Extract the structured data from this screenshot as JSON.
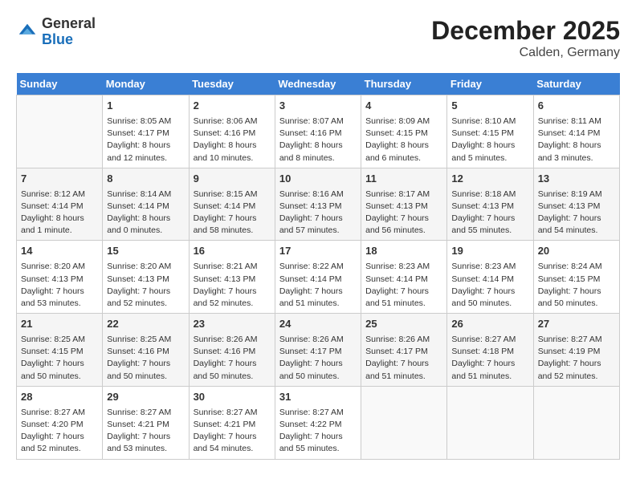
{
  "header": {
    "logo_general": "General",
    "logo_blue": "Blue",
    "month_year": "December 2025",
    "location": "Calden, Germany"
  },
  "weekdays": [
    "Sunday",
    "Monday",
    "Tuesday",
    "Wednesday",
    "Thursday",
    "Friday",
    "Saturday"
  ],
  "weeks": [
    [
      {
        "day": "",
        "empty": true
      },
      {
        "day": "1",
        "sunrise": "Sunrise: 8:05 AM",
        "sunset": "Sunset: 4:17 PM",
        "daylight": "Daylight: 8 hours and 12 minutes."
      },
      {
        "day": "2",
        "sunrise": "Sunrise: 8:06 AM",
        "sunset": "Sunset: 4:16 PM",
        "daylight": "Daylight: 8 hours and 10 minutes."
      },
      {
        "day": "3",
        "sunrise": "Sunrise: 8:07 AM",
        "sunset": "Sunset: 4:16 PM",
        "daylight": "Daylight: 8 hours and 8 minutes."
      },
      {
        "day": "4",
        "sunrise": "Sunrise: 8:09 AM",
        "sunset": "Sunset: 4:15 PM",
        "daylight": "Daylight: 8 hours and 6 minutes."
      },
      {
        "day": "5",
        "sunrise": "Sunrise: 8:10 AM",
        "sunset": "Sunset: 4:15 PM",
        "daylight": "Daylight: 8 hours and 5 minutes."
      },
      {
        "day": "6",
        "sunrise": "Sunrise: 8:11 AM",
        "sunset": "Sunset: 4:14 PM",
        "daylight": "Daylight: 8 hours and 3 minutes."
      }
    ],
    [
      {
        "day": "7",
        "sunrise": "Sunrise: 8:12 AM",
        "sunset": "Sunset: 4:14 PM",
        "daylight": "Daylight: 8 hours and 1 minute."
      },
      {
        "day": "8",
        "sunrise": "Sunrise: 8:14 AM",
        "sunset": "Sunset: 4:14 PM",
        "daylight": "Daylight: 8 hours and 0 minutes."
      },
      {
        "day": "9",
        "sunrise": "Sunrise: 8:15 AM",
        "sunset": "Sunset: 4:14 PM",
        "daylight": "Daylight: 7 hours and 58 minutes."
      },
      {
        "day": "10",
        "sunrise": "Sunrise: 8:16 AM",
        "sunset": "Sunset: 4:13 PM",
        "daylight": "Daylight: 7 hours and 57 minutes."
      },
      {
        "day": "11",
        "sunrise": "Sunrise: 8:17 AM",
        "sunset": "Sunset: 4:13 PM",
        "daylight": "Daylight: 7 hours and 56 minutes."
      },
      {
        "day": "12",
        "sunrise": "Sunrise: 8:18 AM",
        "sunset": "Sunset: 4:13 PM",
        "daylight": "Daylight: 7 hours and 55 minutes."
      },
      {
        "day": "13",
        "sunrise": "Sunrise: 8:19 AM",
        "sunset": "Sunset: 4:13 PM",
        "daylight": "Daylight: 7 hours and 54 minutes."
      }
    ],
    [
      {
        "day": "14",
        "sunrise": "Sunrise: 8:20 AM",
        "sunset": "Sunset: 4:13 PM",
        "daylight": "Daylight: 7 hours and 53 minutes."
      },
      {
        "day": "15",
        "sunrise": "Sunrise: 8:20 AM",
        "sunset": "Sunset: 4:13 PM",
        "daylight": "Daylight: 7 hours and 52 minutes."
      },
      {
        "day": "16",
        "sunrise": "Sunrise: 8:21 AM",
        "sunset": "Sunset: 4:13 PM",
        "daylight": "Daylight: 7 hours and 52 minutes."
      },
      {
        "day": "17",
        "sunrise": "Sunrise: 8:22 AM",
        "sunset": "Sunset: 4:14 PM",
        "daylight": "Daylight: 7 hours and 51 minutes."
      },
      {
        "day": "18",
        "sunrise": "Sunrise: 8:23 AM",
        "sunset": "Sunset: 4:14 PM",
        "daylight": "Daylight: 7 hours and 51 minutes."
      },
      {
        "day": "19",
        "sunrise": "Sunrise: 8:23 AM",
        "sunset": "Sunset: 4:14 PM",
        "daylight": "Daylight: 7 hours and 50 minutes."
      },
      {
        "day": "20",
        "sunrise": "Sunrise: 8:24 AM",
        "sunset": "Sunset: 4:15 PM",
        "daylight": "Daylight: 7 hours and 50 minutes."
      }
    ],
    [
      {
        "day": "21",
        "sunrise": "Sunrise: 8:25 AM",
        "sunset": "Sunset: 4:15 PM",
        "daylight": "Daylight: 7 hours and 50 minutes."
      },
      {
        "day": "22",
        "sunrise": "Sunrise: 8:25 AM",
        "sunset": "Sunset: 4:16 PM",
        "daylight": "Daylight: 7 hours and 50 minutes."
      },
      {
        "day": "23",
        "sunrise": "Sunrise: 8:26 AM",
        "sunset": "Sunset: 4:16 PM",
        "daylight": "Daylight: 7 hours and 50 minutes."
      },
      {
        "day": "24",
        "sunrise": "Sunrise: 8:26 AM",
        "sunset": "Sunset: 4:17 PM",
        "daylight": "Daylight: 7 hours and 50 minutes."
      },
      {
        "day": "25",
        "sunrise": "Sunrise: 8:26 AM",
        "sunset": "Sunset: 4:17 PM",
        "daylight": "Daylight: 7 hours and 51 minutes."
      },
      {
        "day": "26",
        "sunrise": "Sunrise: 8:27 AM",
        "sunset": "Sunset: 4:18 PM",
        "daylight": "Daylight: 7 hours and 51 minutes."
      },
      {
        "day": "27",
        "sunrise": "Sunrise: 8:27 AM",
        "sunset": "Sunset: 4:19 PM",
        "daylight": "Daylight: 7 hours and 52 minutes."
      }
    ],
    [
      {
        "day": "28",
        "sunrise": "Sunrise: 8:27 AM",
        "sunset": "Sunset: 4:20 PM",
        "daylight": "Daylight: 7 hours and 52 minutes."
      },
      {
        "day": "29",
        "sunrise": "Sunrise: 8:27 AM",
        "sunset": "Sunset: 4:21 PM",
        "daylight": "Daylight: 7 hours and 53 minutes."
      },
      {
        "day": "30",
        "sunrise": "Sunrise: 8:27 AM",
        "sunset": "Sunset: 4:21 PM",
        "daylight": "Daylight: 7 hours and 54 minutes."
      },
      {
        "day": "31",
        "sunrise": "Sunrise: 8:27 AM",
        "sunset": "Sunset: 4:22 PM",
        "daylight": "Daylight: 7 hours and 55 minutes."
      },
      {
        "day": "",
        "empty": true
      },
      {
        "day": "",
        "empty": true
      },
      {
        "day": "",
        "empty": true
      }
    ]
  ]
}
